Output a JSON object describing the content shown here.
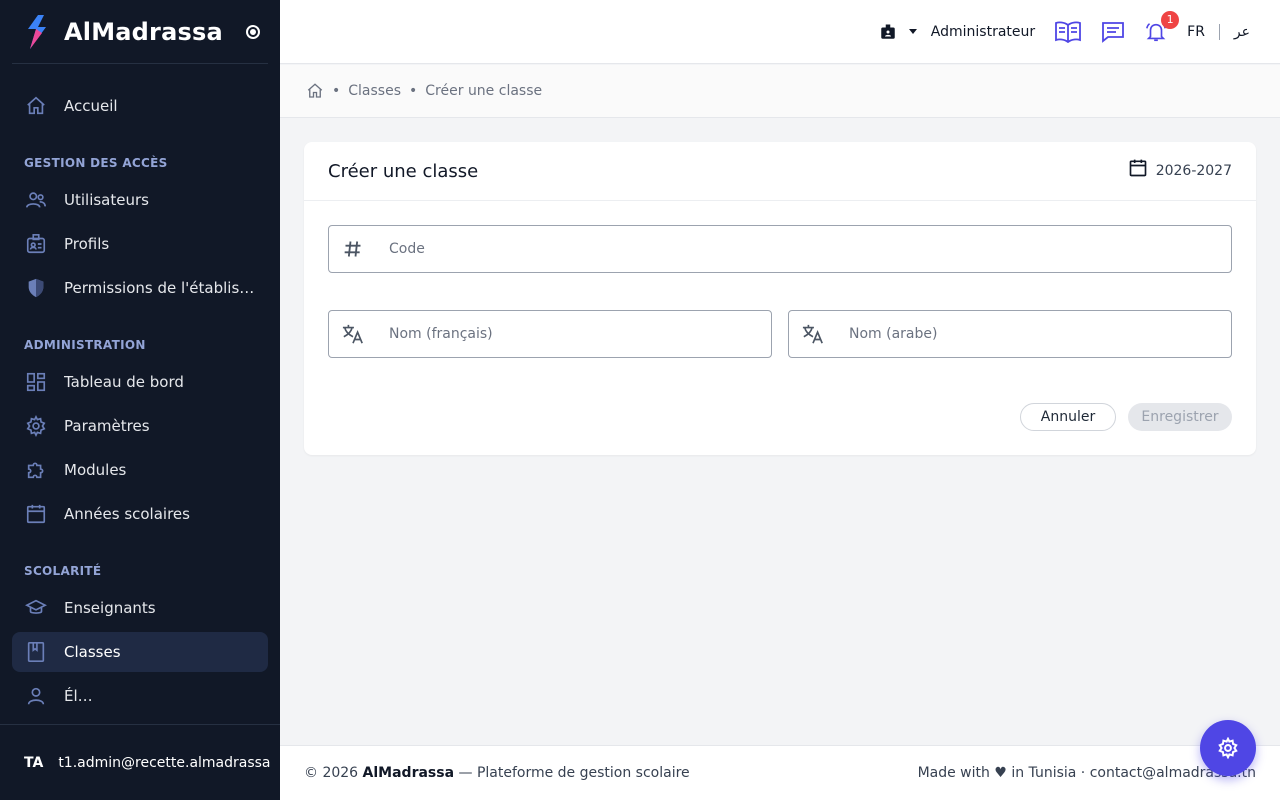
{
  "app": {
    "name": "AlMadrassa"
  },
  "sidebar": {
    "home": {
      "label": "Accueil",
      "icon": "home-icon"
    },
    "sections": [
      {
        "title": "GESTION DES ACCÈS",
        "items": [
          {
            "label": "Utilisateurs",
            "icon": "users-icon"
          },
          {
            "label": "Profils",
            "icon": "id-badge-icon"
          },
          {
            "label": "Permissions de l'établiss…",
            "icon": "shield-icon"
          }
        ]
      },
      {
        "title": "ADMINISTRATION",
        "items": [
          {
            "label": "Tableau de bord",
            "icon": "dashboard-icon"
          },
          {
            "label": "Paramètres",
            "icon": "gear-icon"
          },
          {
            "label": "Modules",
            "icon": "puzzle-icon"
          },
          {
            "label": "Années scolaires",
            "icon": "calendar-icon"
          }
        ]
      },
      {
        "title": "SCOLARITÉ",
        "items": [
          {
            "label": "Enseignants",
            "icon": "graduation-cap-icon"
          },
          {
            "label": "Classes",
            "icon": "bookmark-book-icon",
            "active": true
          },
          {
            "label": "Él…",
            "icon": "student-icon"
          }
        ]
      }
    ],
    "user": {
      "initials": "TA",
      "email": "t1.admin@recette.almadrassa"
    }
  },
  "topbar": {
    "role": "Administrateur",
    "notifications_count": "1",
    "lang_fr": "FR",
    "lang_ar": "عر"
  },
  "breadcrumb": {
    "items": [
      "Classes",
      "Créer une classe"
    ]
  },
  "form": {
    "title": "Créer une classe",
    "school_year": "2026-2027",
    "code_placeholder": "Code",
    "name_fr_placeholder": "Nom (français)",
    "name_ar_placeholder": "Nom (arabe)",
    "cancel_label": "Annuler",
    "save_label": "Enregistrer"
  },
  "footer": {
    "copyright_prefix": "© 2026",
    "brand": "AlMadrassa",
    "tagline": "— Plateforme de gestion scolaire",
    "made_with": "Made with ♥ in Tunisia · contact@almadrassa.tn"
  },
  "colors": {
    "accent": "#4f46e5",
    "sidebar_bg": "#111827",
    "badge": "#ef4444"
  }
}
